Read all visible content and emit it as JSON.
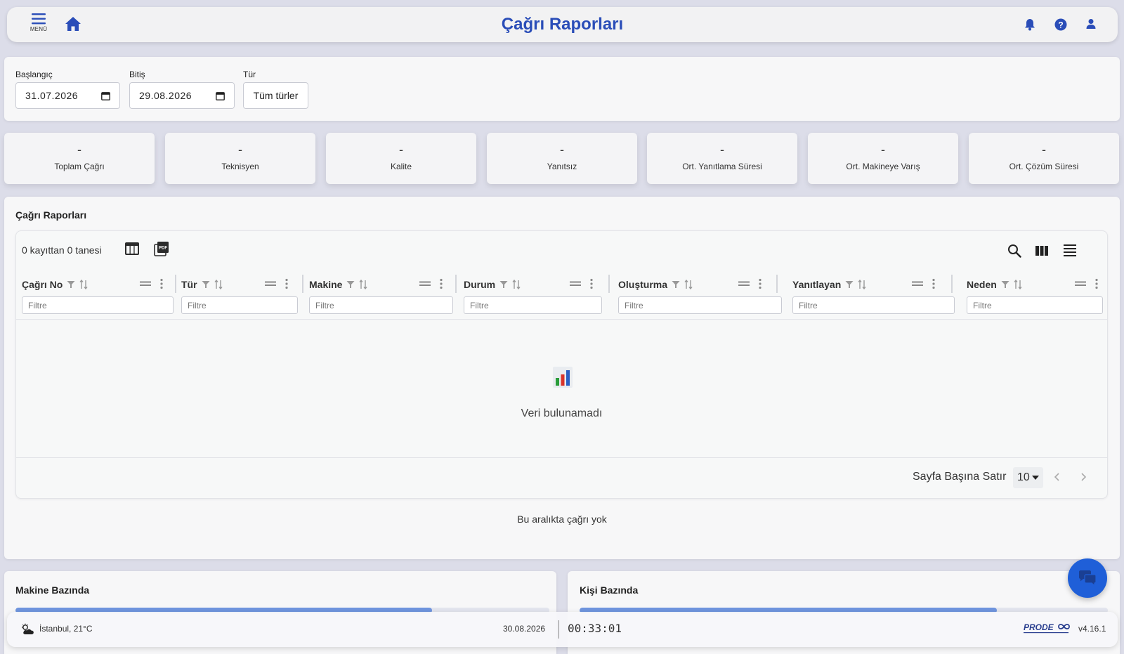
{
  "header": {
    "menu_label": "MENÜ",
    "title": "Çağrı Raporları"
  },
  "filters": {
    "start_label": "Başlangıç",
    "start_value": "31.07.2026",
    "end_label": "Bitiş",
    "end_value": "29.08.2026",
    "type_label": "Tür",
    "type_value": "Tüm türler"
  },
  "stats": [
    {
      "value": "-",
      "label": "Toplam Çağrı"
    },
    {
      "value": "-",
      "label": "Teknisyen"
    },
    {
      "value": "-",
      "label": "Kalite"
    },
    {
      "value": "-",
      "label": "Yanıtsız"
    },
    {
      "value": "-",
      "label": "Ort. Yanıtlama Süresi"
    },
    {
      "value": "-",
      "label": "Ort. Makineye Varış"
    },
    {
      "value": "-",
      "label": "Ort. Çözüm Süresi"
    }
  ],
  "reports": {
    "title": "Çağrı Raporları",
    "record_count": "0 kayıttan 0 tanesi",
    "columns": [
      {
        "name": "Çağrı No",
        "filter_placeholder": "Filtre"
      },
      {
        "name": "Tür",
        "filter_placeholder": "Filtre"
      },
      {
        "name": "Makine",
        "filter_placeholder": "Filtre"
      },
      {
        "name": "Durum",
        "filter_placeholder": "Filtre"
      },
      {
        "name": "Oluşturma",
        "filter_placeholder": "Filtre"
      },
      {
        "name": "Yanıtlayan",
        "filter_placeholder": "Filtre"
      },
      {
        "name": "Neden",
        "filter_placeholder": "Filtre"
      }
    ],
    "empty_text": "Veri bulunamadı",
    "rows_per_page_label": "Sayfa Başına Satır",
    "rows_per_page_value": "10",
    "no_calls_text": "Bu aralıkta çağrı yok"
  },
  "machine_section": {
    "title": "Makine Bazında",
    "progress": 0.78
  },
  "person_section": {
    "title": "Kişi Bazında",
    "progress": 0.79
  },
  "footer": {
    "weather": "İstanbul, 21°C",
    "date": "30.08.2026",
    "time": "00:33:01",
    "logo_text": "PRODE",
    "version": "v4.16.1"
  },
  "colors": {
    "accent": "#2a4db8",
    "fab": "#1f5fd8",
    "progress": "#6f95de"
  }
}
